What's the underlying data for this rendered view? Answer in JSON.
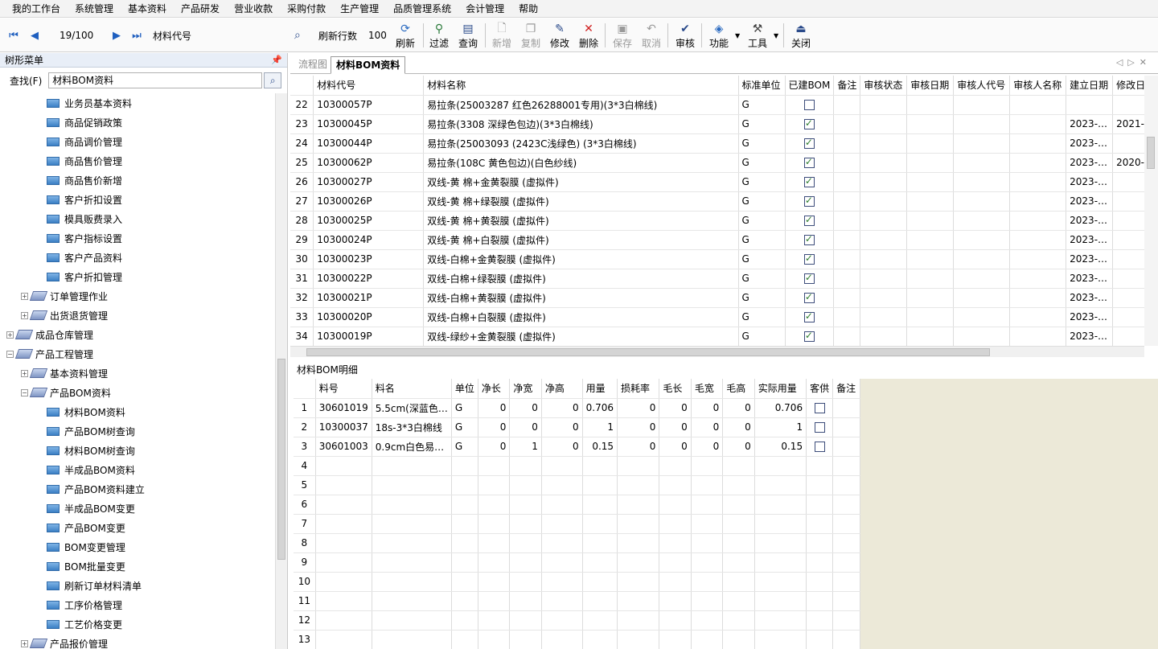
{
  "menu": [
    "我的工作台",
    "系统管理",
    "基本资料",
    "产品研发",
    "营业收款",
    "采购付款",
    "生产管理",
    "品质管理系统",
    "会计管理",
    "帮助"
  ],
  "toolbar": {
    "record_position": "19/100",
    "field_label": "材料代号",
    "refresh_rows_label": "刷新行数",
    "refresh_rows_value": "100",
    "buttons": {
      "refresh": "刷新",
      "filter": "过滤",
      "query": "查询",
      "add": "新增",
      "copy": "复制",
      "edit": "修改",
      "delete": "删除",
      "save": "保存",
      "cancel": "取消",
      "audit": "审核",
      "function": "功能",
      "tools": "工具",
      "close": "关闭"
    }
  },
  "left_panel": {
    "title": "树形菜单",
    "search_label": "查找(F)",
    "search_value": "材料BOM资料",
    "tree": [
      {
        "label": "业务员基本资料",
        "level": 3,
        "type": "leaf"
      },
      {
        "label": "商品促销政策",
        "level": 3,
        "type": "leaf"
      },
      {
        "label": "商品调价管理",
        "level": 3,
        "type": "leaf"
      },
      {
        "label": "商品售价管理",
        "level": 3,
        "type": "leaf"
      },
      {
        "label": "商品售价新增",
        "level": 3,
        "type": "leaf"
      },
      {
        "label": "客户折扣设置",
        "level": 3,
        "type": "leaf"
      },
      {
        "label": "模具贩费录入",
        "level": 3,
        "type": "leaf"
      },
      {
        "label": "客户指标设置",
        "level": 3,
        "type": "leaf"
      },
      {
        "label": "客户产品资料",
        "level": 3,
        "type": "leaf"
      },
      {
        "label": "客户折扣管理",
        "level": 3,
        "type": "leaf"
      },
      {
        "label": "订单管理作业",
        "level": 2,
        "type": "group",
        "expanded": false
      },
      {
        "label": "出货退货管理",
        "level": 2,
        "type": "group",
        "expanded": false
      },
      {
        "label": "成品仓库管理",
        "level": 1,
        "type": "group",
        "expanded": false
      },
      {
        "label": "产品工程管理",
        "level": 1,
        "type": "group",
        "expanded": true
      },
      {
        "label": "基本资料管理",
        "level": 2,
        "type": "group",
        "expanded": false
      },
      {
        "label": "产品BOM资料",
        "level": 2,
        "type": "group",
        "expanded": true
      },
      {
        "label": "材料BOM资料",
        "level": 3,
        "type": "leaf"
      },
      {
        "label": "产品BOM树查询",
        "level": 3,
        "type": "leaf"
      },
      {
        "label": "材料BOM树查询",
        "level": 3,
        "type": "leaf"
      },
      {
        "label": "半成品BOM资料",
        "level": 3,
        "type": "leaf"
      },
      {
        "label": "产品BOM资料建立",
        "level": 3,
        "type": "leaf"
      },
      {
        "label": "半成品BOM变更",
        "level": 3,
        "type": "leaf"
      },
      {
        "label": "产品BOM变更",
        "level": 3,
        "type": "leaf"
      },
      {
        "label": "BOM变更管理",
        "level": 3,
        "type": "leaf"
      },
      {
        "label": "BOM批量变更",
        "level": 3,
        "type": "leaf"
      },
      {
        "label": "刷新订单材料清单",
        "level": 3,
        "type": "leaf"
      },
      {
        "label": "工序价格管理",
        "level": 3,
        "type": "leaf"
      },
      {
        "label": "工艺价格变更",
        "level": 3,
        "type": "leaf"
      },
      {
        "label": "产品报价管理",
        "level": 2,
        "type": "group",
        "expanded": false
      }
    ]
  },
  "tabs": [
    {
      "label": "流程图",
      "active": false
    },
    {
      "label": "材料BOM资料",
      "active": true
    }
  ],
  "main_grid": {
    "columns": [
      "",
      "材料代号",
      "材料名称",
      "标准单位",
      "已建BOM",
      "备注",
      "审核状态",
      "审核日期",
      "审核人代号",
      "审核人名称",
      "建立日期",
      "修改日"
    ],
    "rows": [
      {
        "no": "22",
        "code": "10300057P",
        "name": "易拉条(25003287 红色26288001专用)(3*3白棉线)",
        "unit": "G",
        "bom": false,
        "created": "",
        "modified": ""
      },
      {
        "no": "23",
        "code": "10300045P",
        "name": "易拉条(3308 深绿色包边)(3*3白棉线)",
        "unit": "G",
        "bom": true,
        "created": "2023-…",
        "modified": "2021-…"
      },
      {
        "no": "24",
        "code": "10300044P",
        "name": "易拉条(25003093 (2423C浅绿色) (3*3白棉线)",
        "unit": "G",
        "bom": true,
        "created": "2023-…",
        "modified": ""
      },
      {
        "no": "25",
        "code": "10300062P",
        "name": "易拉条(108C 黄色包边)(白色纱线)",
        "unit": "G",
        "bom": true,
        "created": "2023-…",
        "modified": "2020-…"
      },
      {
        "no": "26",
        "code": "10300027P",
        "name": "双线-黄 棉+金黄裂膜 (虚拟件)",
        "unit": "G",
        "bom": true,
        "created": "2023-…",
        "modified": ""
      },
      {
        "no": "27",
        "code": "10300026P",
        "name": "双线-黄 棉+绿裂膜 (虚拟件)",
        "unit": "G",
        "bom": true,
        "created": "2023-…",
        "modified": ""
      },
      {
        "no": "28",
        "code": "10300025P",
        "name": "双线-黄 棉+黄裂膜 (虚拟件)",
        "unit": "G",
        "bom": true,
        "created": "2023-…",
        "modified": ""
      },
      {
        "no": "29",
        "code": "10300024P",
        "name": "双线-黄 棉+白裂膜 (虚拟件)",
        "unit": "G",
        "bom": true,
        "created": "2023-…",
        "modified": ""
      },
      {
        "no": "30",
        "code": "10300023P",
        "name": "双线-白棉+金黄裂膜 (虚拟件)",
        "unit": "G",
        "bom": true,
        "created": "2023-…",
        "modified": ""
      },
      {
        "no": "31",
        "code": "10300022P",
        "name": "双线-白棉+绿裂膜 (虚拟件)",
        "unit": "G",
        "bom": true,
        "created": "2023-…",
        "modified": ""
      },
      {
        "no": "32",
        "code": "10300021P",
        "name": "双线-白棉+黄裂膜 (虚拟件)",
        "unit": "G",
        "bom": true,
        "created": "2023-…",
        "modified": ""
      },
      {
        "no": "33",
        "code": "10300020P",
        "name": "双线-白棉+白裂膜 (虚拟件)",
        "unit": "G",
        "bom": true,
        "created": "2023-…",
        "modified": ""
      },
      {
        "no": "34",
        "code": "10300019P",
        "name": "双线-绿纱+金黄裂膜 (虚拟件)",
        "unit": "G",
        "bom": true,
        "created": "2023-…",
        "modified": ""
      }
    ]
  },
  "detail": {
    "title": "材料BOM明细",
    "columns": [
      "",
      "料号",
      "料名",
      "单位",
      "净长",
      "净宽",
      "净高",
      "用量",
      "损耗率",
      "毛长",
      "毛宽",
      "毛高",
      "实际用量",
      "客供",
      "备注"
    ],
    "rows": [
      {
        "no": "1",
        "code": "30601019",
        "name": "5.5cm(深蓝色…",
        "unit": "G",
        "l": "0",
        "w": "0",
        "h": "0",
        "qty": "0.706",
        "loss": "0",
        "gl": "0",
        "gw": "0",
        "gh": "0",
        "actual": "0.706"
      },
      {
        "no": "2",
        "code": "10300037",
        "name": "18s-3*3白棉线",
        "unit": "G",
        "l": "0",
        "w": "0",
        "h": "0",
        "qty": "1",
        "loss": "0",
        "gl": "0",
        "gw": "0",
        "gh": "0",
        "actual": "1"
      },
      {
        "no": "3",
        "code": "30601003",
        "name": "0.9cm白色易…",
        "unit": "G",
        "l": "0",
        "w": "1",
        "h": "0",
        "qty": "0.15",
        "loss": "0",
        "gl": "0",
        "gw": "0",
        "gh": "0",
        "actual": "0.15"
      }
    ],
    "empty_row_numbers": [
      "4",
      "5",
      "6",
      "7",
      "8",
      "9",
      "10",
      "11",
      "12",
      "13"
    ]
  }
}
